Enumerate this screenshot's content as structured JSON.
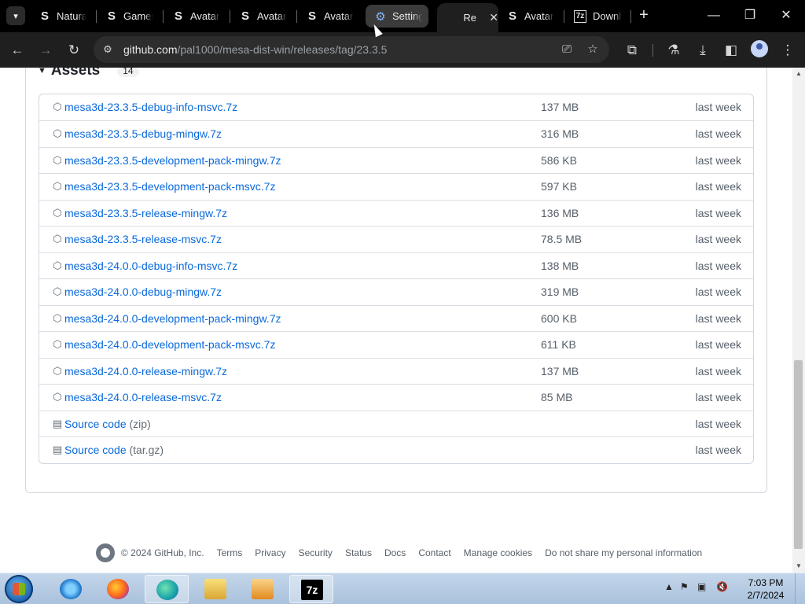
{
  "browser": {
    "tabs": [
      {
        "icon": "S",
        "title": "Natura"
      },
      {
        "icon": "S",
        "title": "Games"
      },
      {
        "icon": "S",
        "title": "Avatar"
      },
      {
        "icon": "S",
        "title": "Avatar"
      },
      {
        "icon": "S",
        "title": "Avatar"
      },
      {
        "icon": "⚙",
        "title": "Setting"
      },
      {
        "icon": "",
        "title": "Re"
      },
      {
        "icon": "S",
        "title": "Avatar"
      },
      {
        "icon": "7z",
        "title": "Downl"
      }
    ],
    "url_host": "github.com",
    "url_path": "/pal1000/mesa-dist-win/releases/tag/23.3.5"
  },
  "assets": {
    "title": "Assets",
    "count": "14",
    "rows": [
      {
        "name": "mesa3d-23.3.5-debug-info-msvc.7z",
        "sub": "",
        "size": "137 MB",
        "date": "last week"
      },
      {
        "name": "mesa3d-23.3.5-debug-mingw.7z",
        "sub": "",
        "size": "316 MB",
        "date": "last week"
      },
      {
        "name": "mesa3d-23.3.5-development-pack-mingw.7z",
        "sub": "",
        "size": "586 KB",
        "date": "last week"
      },
      {
        "name": "mesa3d-23.3.5-development-pack-msvc.7z",
        "sub": "",
        "size": "597 KB",
        "date": "last week"
      },
      {
        "name": "mesa3d-23.3.5-release-mingw.7z",
        "sub": "",
        "size": "136 MB",
        "date": "last week"
      },
      {
        "name": "mesa3d-23.3.5-release-msvc.7z",
        "sub": "",
        "size": "78.5 MB",
        "date": "last week"
      },
      {
        "name": "mesa3d-24.0.0-debug-info-msvc.7z",
        "sub": "",
        "size": "138 MB",
        "date": "last week"
      },
      {
        "name": "mesa3d-24.0.0-debug-mingw.7z",
        "sub": "",
        "size": "319 MB",
        "date": "last week"
      },
      {
        "name": "mesa3d-24.0.0-development-pack-mingw.7z",
        "sub": "",
        "size": "600 KB",
        "date": "last week"
      },
      {
        "name": "mesa3d-24.0.0-development-pack-msvc.7z",
        "sub": "",
        "size": "611 KB",
        "date": "last week"
      },
      {
        "name": "mesa3d-24.0.0-release-mingw.7z",
        "sub": "",
        "size": "137 MB",
        "date": "last week"
      },
      {
        "name": "mesa3d-24.0.0-release-msvc.7z",
        "sub": "",
        "size": "85 MB",
        "date": "last week"
      },
      {
        "name": "Source code",
        "sub": "(zip)",
        "size": "",
        "date": "last week"
      },
      {
        "name": "Source code",
        "sub": "(tar.gz)",
        "size": "",
        "date": "last week"
      }
    ]
  },
  "footer": {
    "copyright": "© 2024 GitHub, Inc.",
    "links": [
      "Terms",
      "Privacy",
      "Security",
      "Status",
      "Docs",
      "Contact",
      "Manage cookies",
      "Do not share my personal information"
    ]
  },
  "taskbar": {
    "time": "7:03 PM",
    "date": "2/7/2024"
  },
  "colors": {
    "link": "#0969da",
    "muted": "#57606a",
    "border": "#d0d7de",
    "chrome_dark": "#1f1f1f"
  }
}
